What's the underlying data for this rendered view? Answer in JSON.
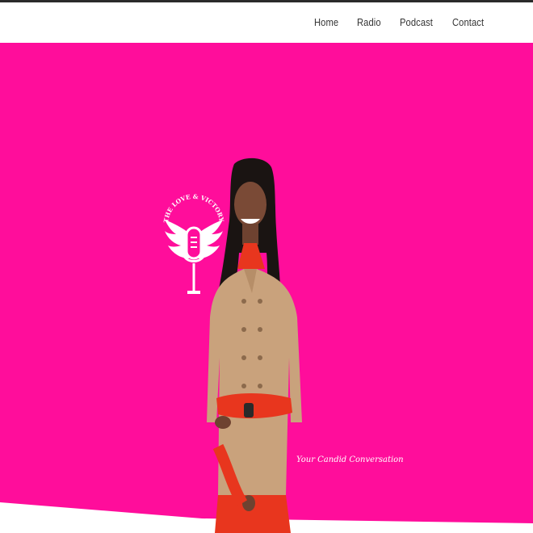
{
  "nav": {
    "items": [
      {
        "label": "Home"
      },
      {
        "label": "Radio"
      },
      {
        "label": "Podcast"
      },
      {
        "label": "Contact"
      }
    ]
  },
  "hero": {
    "logo_text": "THE LOVE & VICTORY SHOW WITH VI",
    "tagline": "Your Candid Conversation"
  },
  "colors": {
    "hero_background": "#ff0d9b",
    "header_background": "#ffffff",
    "nav_text": "#333333"
  }
}
